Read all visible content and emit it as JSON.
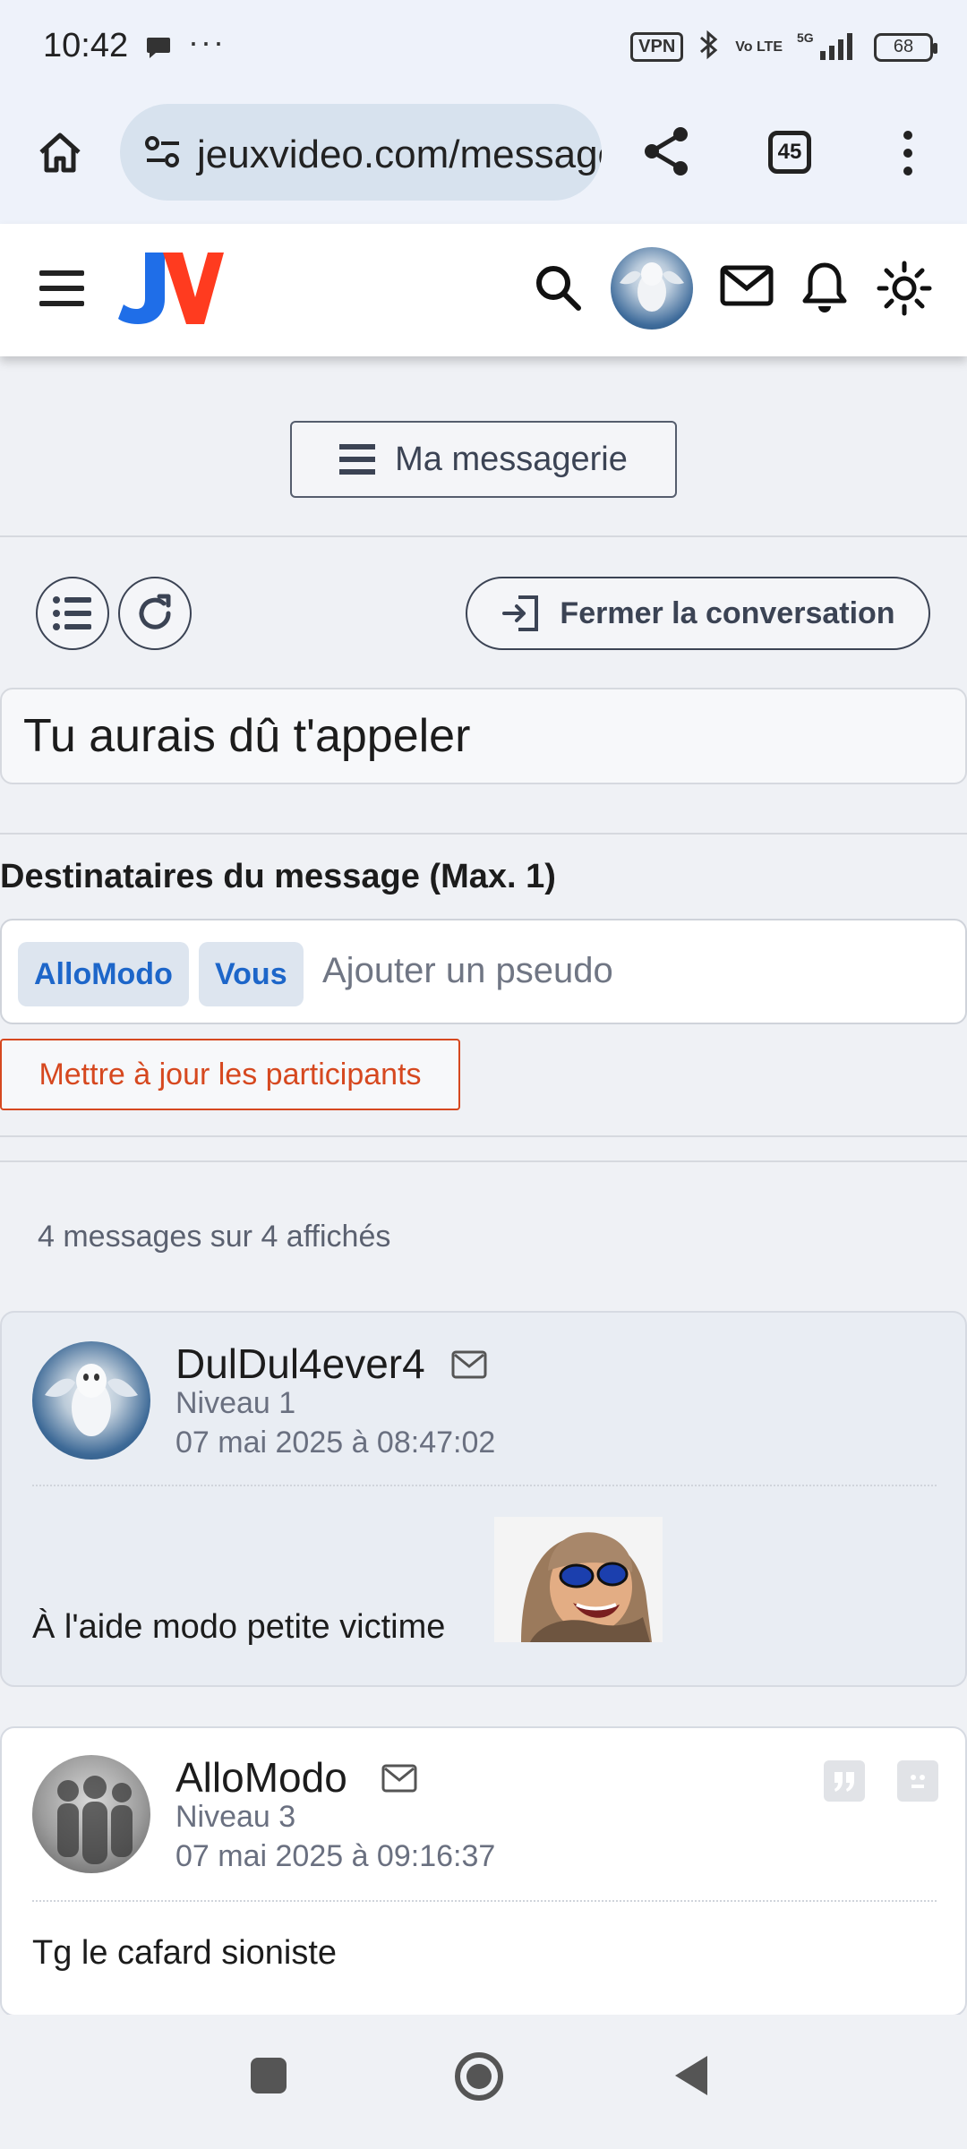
{
  "status_bar": {
    "time": "10:42",
    "dots": "···",
    "vpn": "VPN",
    "volte": "Vo LTE",
    "network": "5G",
    "battery": "68"
  },
  "browser": {
    "url": "jeuxvideo.com/messages-privés",
    "tab_count": "45"
  },
  "site_header": {
    "logo_text": "JV",
    "logo_colors": [
      "#1f6ee8",
      "#ff3b1f"
    ]
  },
  "toolbar": {
    "messagerie_label": "Ma messagerie",
    "close_conversation_label": "Fermer la conversation"
  },
  "conversation": {
    "subject": "Tu aurais dû t'appeler"
  },
  "recipients": {
    "label": "Destinataires du message (Max. 1)",
    "chips": [
      "AlloModo",
      "Vous"
    ],
    "placeholder": "Ajouter un pseudo",
    "update_label": "Mettre à jour les participants"
  },
  "messages": {
    "count_text": "4 messages sur 4 affichés",
    "items": [
      {
        "author": "DulDul4ever4",
        "level": "Niveau 1",
        "date": "07 mai 2025 à 08:47:02",
        "text": "À l'aide modo petite victime"
      },
      {
        "author": "AlloModo",
        "level": "Niveau 3",
        "date": "07 mai 2025 à 09:16:37",
        "text": "Tg le cafard sioniste"
      }
    ]
  },
  "colors": {
    "accent_blue": "#1d66c9",
    "accent_orange": "#d6481f",
    "page_bg": "#eff1f5"
  }
}
